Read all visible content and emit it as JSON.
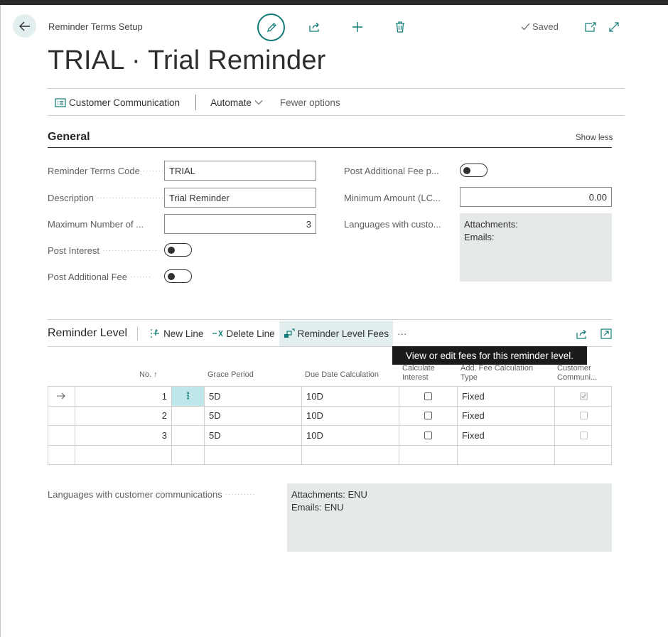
{
  "header": {
    "page_caption": "Reminder Terms Setup",
    "title": "TRIAL · Trial Reminder",
    "saved_label": "Saved"
  },
  "actionbar": {
    "customer_communication": "Customer Communication",
    "automate": "Automate",
    "fewer_options": "Fewer options"
  },
  "general": {
    "title": "General",
    "show_less": "Show less",
    "fields": {
      "code_label": "Reminder Terms Code",
      "code_value": "TRIAL",
      "description_label": "Description",
      "description_value": "Trial Reminder",
      "max_reminders_label": "Maximum Number of ...",
      "max_reminders_value": "3",
      "post_interest_label": "Post Interest",
      "post_interest_on": false,
      "post_fee_label": "Post Additional Fee",
      "post_fee_on": false,
      "post_fee_per_line_label": "Post Additional Fee p...",
      "post_fee_per_line_on": false,
      "min_amount_label": "Minimum Amount (LC...",
      "min_amount_value": "0.00",
      "languages_label": "Languages with custo...",
      "languages_value": "Attachments:\nEmails:"
    }
  },
  "reminder_level": {
    "title": "Reminder Level",
    "new_line": "New Line",
    "delete_line": "Delete Line",
    "level_fees": "Reminder Level Fees",
    "more": "···",
    "tooltip": "View or edit fees for this reminder level.",
    "columns": {
      "no": "No. ↑",
      "grace": "Grace Period",
      "due": "Due Date Calculation",
      "calc_interest": "Calculate\nInterest",
      "add_fee_type": "Add. Fee Calculation\nType",
      "cust_comm": "Customer\nCommuni..."
    },
    "rows": [
      {
        "no": "1",
        "grace": "5D",
        "due": "10D",
        "calc_interest": false,
        "fee_type": "Fixed",
        "cust_comm": true
      },
      {
        "no": "2",
        "grace": "5D",
        "due": "10D",
        "calc_interest": false,
        "fee_type": "Fixed",
        "cust_comm": false
      },
      {
        "no": "3",
        "grace": "5D",
        "due": "10D",
        "calc_interest": false,
        "fee_type": "Fixed",
        "cust_comm": false
      }
    ]
  },
  "footer": {
    "languages_label": "Languages with customer communications",
    "languages_value": "Attachments: ENU\nEmails: ENU"
  },
  "colors": {
    "accent": "#0f7b76",
    "active_bg": "#e3eeef",
    "tooltip_bg": "#1b1b1b",
    "grey_box": "#e6e9ea"
  }
}
